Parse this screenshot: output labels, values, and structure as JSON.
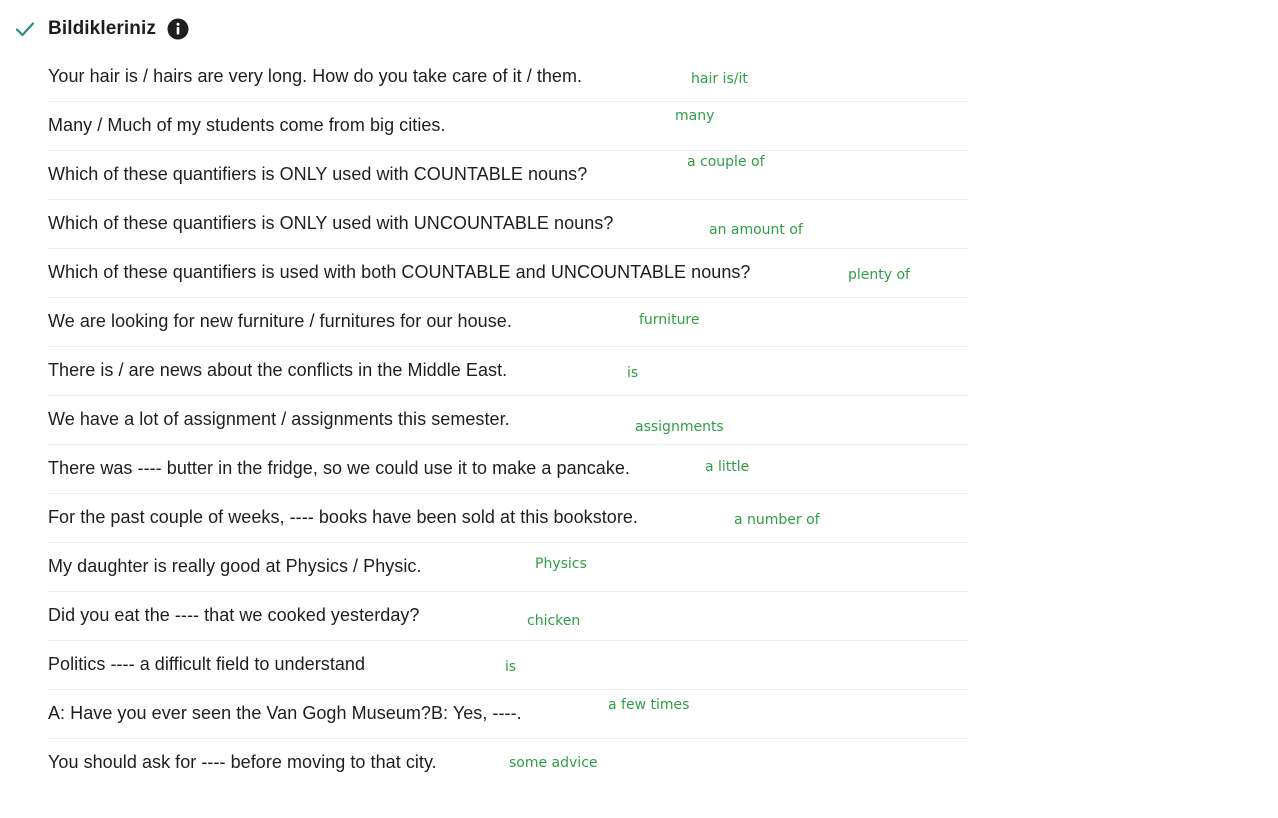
{
  "header": {
    "title": "Bildikleriniz",
    "check_icon": "checkmark-icon",
    "info_icon": "info-icon",
    "accent_color": "#2a8c7e"
  },
  "items": [
    {
      "question": "Your hair is / hairs are very long. How do you take care of it / them.",
      "answer": "hair is/it"
    },
    {
      "question": "Many / Much of my students come from big cities.",
      "answer": "many"
    },
    {
      "question": "Which of these quantifiers is ONLY used with COUNTABLE nouns?",
      "answer": "a couple of"
    },
    {
      "question": "Which of these quantifiers is ONLY used with UNCOUNTABLE nouns?",
      "answer": "an amount of"
    },
    {
      "question": "Which of these quantifiers is used with both COUNTABLE and UNCOUNTABLE nouns?",
      "answer": "plenty of"
    },
    {
      "question": "We are looking for new furniture / furnitures for our house.",
      "answer": "furniture"
    },
    {
      "question": "There is / are news about the conflicts in the Middle East.",
      "answer": "is"
    },
    {
      "question": "We have a lot of assignment / assignments this semester.",
      "answer": "assignments"
    },
    {
      "question": "There was ---- butter in the fridge, so we could use it to make a pancake.",
      "answer": "a little"
    },
    {
      "question": "For the past couple of weeks, ---- books have been sold at this bookstore.",
      "answer": "a number of"
    },
    {
      "question": "My daughter is really good at Physics / Physic.",
      "answer": "Physics"
    },
    {
      "question": "Did you eat the ---- that we cooked yesterday?",
      "answer": "chicken"
    },
    {
      "question": "Politics ---- a difficult field to understand",
      "answer": "is"
    },
    {
      "question": "A: Have you ever seen the Van Gogh Museum?B: Yes, ----.",
      "answer": "a few times"
    },
    {
      "question": "You should ask for ---- before moving to that city.",
      "answer": "some advice"
    }
  ],
  "answer_color": "#2f9e44"
}
